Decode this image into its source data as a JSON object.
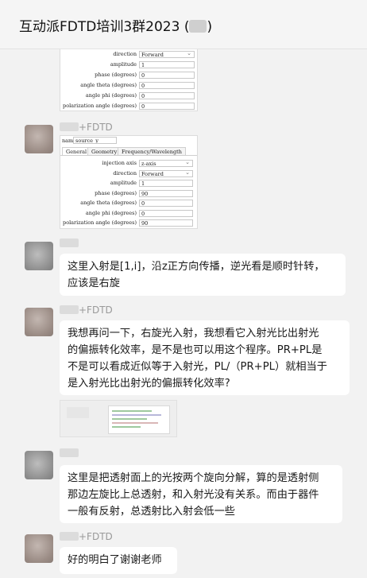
{
  "header": {
    "title": "互动派FDTD培训3群2023 (",
    "title_end": ")"
  },
  "shot1": {
    "rows": [
      {
        "label": "direction",
        "value": "Forward"
      },
      {
        "label": "amplitude",
        "value": "1"
      },
      {
        "label": "phase (degrees)",
        "value": "0"
      },
      {
        "label": "angle theta (degrees)",
        "value": "0"
      },
      {
        "label": "angle phi (degrees)",
        "value": "0"
      },
      {
        "label": "polarization angle (degrees)",
        "value": "0"
      }
    ]
  },
  "msg1": {
    "sender": "+FDTD",
    "shot": {
      "name_label": "name",
      "name_value": "source_y",
      "tabs": [
        "General",
        "Geometry",
        "Frequency/Wavelength"
      ],
      "rows": [
        {
          "label": "injection axis",
          "value": "z-axis"
        },
        {
          "label": "direction",
          "value": "Forward"
        },
        {
          "label": "amplitude",
          "value": "1"
        },
        {
          "label": "phase (degrees)",
          "value": "90"
        },
        {
          "label": "angle theta (degrees)",
          "value": "0"
        },
        {
          "label": "angle phi (degrees)",
          "value": "0"
        },
        {
          "label": "polarization angle (degrees)",
          "value": "90"
        }
      ]
    }
  },
  "msg2": {
    "lines": [
      "这里入射是[1,i]，沿z正方向传播，逆光看是顺时针转，",
      "应该是右旋"
    ]
  },
  "msg3": {
    "sender": "+FDTD",
    "lines": [
      "我想再问一下，右旋光入射，我想看它入射光比出射光",
      "的偏振转化效率，是不是也可以用这个程序。PR+PL是",
      "不是可以看成近似等于入射光，PL/（PR+PL）就相当于",
      "是入射光比出射光的偏振转化效率?"
    ]
  },
  "msg4": {
    "lines": [
      "这里是把透射面上的光按两个旋向分解，算的是透射侧",
      "那边左旋比上总透射，和入射光没有关系。而由于器件",
      "一般有反射，总透射比入射会低一些"
    ]
  },
  "msg5": {
    "sender": "+FDTD",
    "lines": [
      "好的明白了谢谢老师"
    ]
  }
}
